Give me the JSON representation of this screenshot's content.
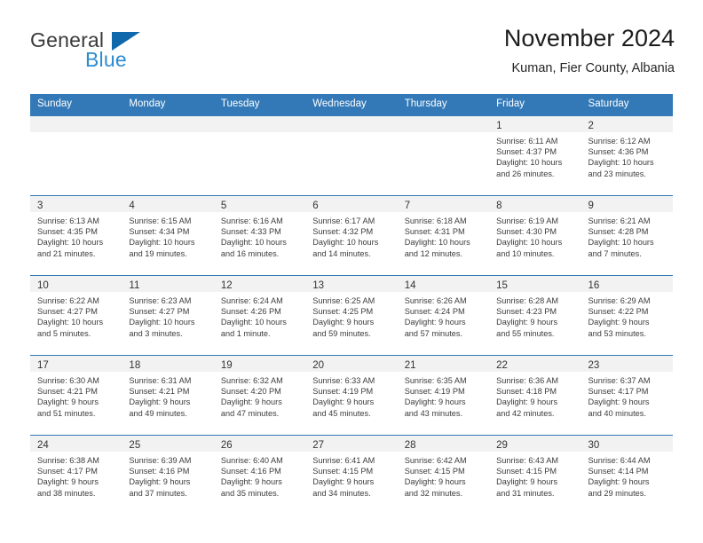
{
  "brand": {
    "word_one": "General",
    "word_two": "Blue",
    "triangle_color": "#0f68ab",
    "blue_color": "#2e8bd0"
  },
  "header": {
    "title": "November 2024",
    "subtitle": "Kuman, Fier County, Albania",
    "accent_color": "#3379b8"
  },
  "calendar": {
    "day_headers": [
      "Sunday",
      "Monday",
      "Tuesday",
      "Wednesday",
      "Thursday",
      "Friday",
      "Saturday"
    ],
    "labels": {
      "sunrise": "Sunrise:",
      "sunset": "Sunset:",
      "daylight": "Daylight:"
    },
    "weeks": [
      [
        {
          "day": "",
          "empty": true
        },
        {
          "day": "",
          "empty": true
        },
        {
          "day": "",
          "empty": true
        },
        {
          "day": "",
          "empty": true
        },
        {
          "day": "",
          "empty": true
        },
        {
          "day": "1",
          "sunrise": "Sunrise: 6:11 AM",
          "sunset": "Sunset: 4:37 PM",
          "daylight_line1": "Daylight: 10 hours",
          "daylight_line2": "and 26 minutes."
        },
        {
          "day": "2",
          "sunrise": "Sunrise: 6:12 AM",
          "sunset": "Sunset: 4:36 PM",
          "daylight_line1": "Daylight: 10 hours",
          "daylight_line2": "and 23 minutes."
        }
      ],
      [
        {
          "day": "3",
          "sunrise": "Sunrise: 6:13 AM",
          "sunset": "Sunset: 4:35 PM",
          "daylight_line1": "Daylight: 10 hours",
          "daylight_line2": "and 21 minutes."
        },
        {
          "day": "4",
          "sunrise": "Sunrise: 6:15 AM",
          "sunset": "Sunset: 4:34 PM",
          "daylight_line1": "Daylight: 10 hours",
          "daylight_line2": "and 19 minutes."
        },
        {
          "day": "5",
          "sunrise": "Sunrise: 6:16 AM",
          "sunset": "Sunset: 4:33 PM",
          "daylight_line1": "Daylight: 10 hours",
          "daylight_line2": "and 16 minutes."
        },
        {
          "day": "6",
          "sunrise": "Sunrise: 6:17 AM",
          "sunset": "Sunset: 4:32 PM",
          "daylight_line1": "Daylight: 10 hours",
          "daylight_line2": "and 14 minutes."
        },
        {
          "day": "7",
          "sunrise": "Sunrise: 6:18 AM",
          "sunset": "Sunset: 4:31 PM",
          "daylight_line1": "Daylight: 10 hours",
          "daylight_line2": "and 12 minutes."
        },
        {
          "day": "8",
          "sunrise": "Sunrise: 6:19 AM",
          "sunset": "Sunset: 4:30 PM",
          "daylight_line1": "Daylight: 10 hours",
          "daylight_line2": "and 10 minutes."
        },
        {
          "day": "9",
          "sunrise": "Sunrise: 6:21 AM",
          "sunset": "Sunset: 4:28 PM",
          "daylight_line1": "Daylight: 10 hours",
          "daylight_line2": "and 7 minutes."
        }
      ],
      [
        {
          "day": "10",
          "sunrise": "Sunrise: 6:22 AM",
          "sunset": "Sunset: 4:27 PM",
          "daylight_line1": "Daylight: 10 hours",
          "daylight_line2": "and 5 minutes."
        },
        {
          "day": "11",
          "sunrise": "Sunrise: 6:23 AM",
          "sunset": "Sunset: 4:27 PM",
          "daylight_line1": "Daylight: 10 hours",
          "daylight_line2": "and 3 minutes."
        },
        {
          "day": "12",
          "sunrise": "Sunrise: 6:24 AM",
          "sunset": "Sunset: 4:26 PM",
          "daylight_line1": "Daylight: 10 hours",
          "daylight_line2": "and 1 minute."
        },
        {
          "day": "13",
          "sunrise": "Sunrise: 6:25 AM",
          "sunset": "Sunset: 4:25 PM",
          "daylight_line1": "Daylight: 9 hours",
          "daylight_line2": "and 59 minutes."
        },
        {
          "day": "14",
          "sunrise": "Sunrise: 6:26 AM",
          "sunset": "Sunset: 4:24 PM",
          "daylight_line1": "Daylight: 9 hours",
          "daylight_line2": "and 57 minutes."
        },
        {
          "day": "15",
          "sunrise": "Sunrise: 6:28 AM",
          "sunset": "Sunset: 4:23 PM",
          "daylight_line1": "Daylight: 9 hours",
          "daylight_line2": "and 55 minutes."
        },
        {
          "day": "16",
          "sunrise": "Sunrise: 6:29 AM",
          "sunset": "Sunset: 4:22 PM",
          "daylight_line1": "Daylight: 9 hours",
          "daylight_line2": "and 53 minutes."
        }
      ],
      [
        {
          "day": "17",
          "sunrise": "Sunrise: 6:30 AM",
          "sunset": "Sunset: 4:21 PM",
          "daylight_line1": "Daylight: 9 hours",
          "daylight_line2": "and 51 minutes."
        },
        {
          "day": "18",
          "sunrise": "Sunrise: 6:31 AM",
          "sunset": "Sunset: 4:21 PM",
          "daylight_line1": "Daylight: 9 hours",
          "daylight_line2": "and 49 minutes."
        },
        {
          "day": "19",
          "sunrise": "Sunrise: 6:32 AM",
          "sunset": "Sunset: 4:20 PM",
          "daylight_line1": "Daylight: 9 hours",
          "daylight_line2": "and 47 minutes."
        },
        {
          "day": "20",
          "sunrise": "Sunrise: 6:33 AM",
          "sunset": "Sunset: 4:19 PM",
          "daylight_line1": "Daylight: 9 hours",
          "daylight_line2": "and 45 minutes."
        },
        {
          "day": "21",
          "sunrise": "Sunrise: 6:35 AM",
          "sunset": "Sunset: 4:19 PM",
          "daylight_line1": "Daylight: 9 hours",
          "daylight_line2": "and 43 minutes."
        },
        {
          "day": "22",
          "sunrise": "Sunrise: 6:36 AM",
          "sunset": "Sunset: 4:18 PM",
          "daylight_line1": "Daylight: 9 hours",
          "daylight_line2": "and 42 minutes."
        },
        {
          "day": "23",
          "sunrise": "Sunrise: 6:37 AM",
          "sunset": "Sunset: 4:17 PM",
          "daylight_line1": "Daylight: 9 hours",
          "daylight_line2": "and 40 minutes."
        }
      ],
      [
        {
          "day": "24",
          "sunrise": "Sunrise: 6:38 AM",
          "sunset": "Sunset: 4:17 PM",
          "daylight_line1": "Daylight: 9 hours",
          "daylight_line2": "and 38 minutes."
        },
        {
          "day": "25",
          "sunrise": "Sunrise: 6:39 AM",
          "sunset": "Sunset: 4:16 PM",
          "daylight_line1": "Daylight: 9 hours",
          "daylight_line2": "and 37 minutes."
        },
        {
          "day": "26",
          "sunrise": "Sunrise: 6:40 AM",
          "sunset": "Sunset: 4:16 PM",
          "daylight_line1": "Daylight: 9 hours",
          "daylight_line2": "and 35 minutes."
        },
        {
          "day": "27",
          "sunrise": "Sunrise: 6:41 AM",
          "sunset": "Sunset: 4:15 PM",
          "daylight_line1": "Daylight: 9 hours",
          "daylight_line2": "and 34 minutes."
        },
        {
          "day": "28",
          "sunrise": "Sunrise: 6:42 AM",
          "sunset": "Sunset: 4:15 PM",
          "daylight_line1": "Daylight: 9 hours",
          "daylight_line2": "and 32 minutes."
        },
        {
          "day": "29",
          "sunrise": "Sunrise: 6:43 AM",
          "sunset": "Sunset: 4:15 PM",
          "daylight_line1": "Daylight: 9 hours",
          "daylight_line2": "and 31 minutes."
        },
        {
          "day": "30",
          "sunrise": "Sunrise: 6:44 AM",
          "sunset": "Sunset: 4:14 PM",
          "daylight_line1": "Daylight: 9 hours",
          "daylight_line2": "and 29 minutes."
        }
      ]
    ]
  }
}
